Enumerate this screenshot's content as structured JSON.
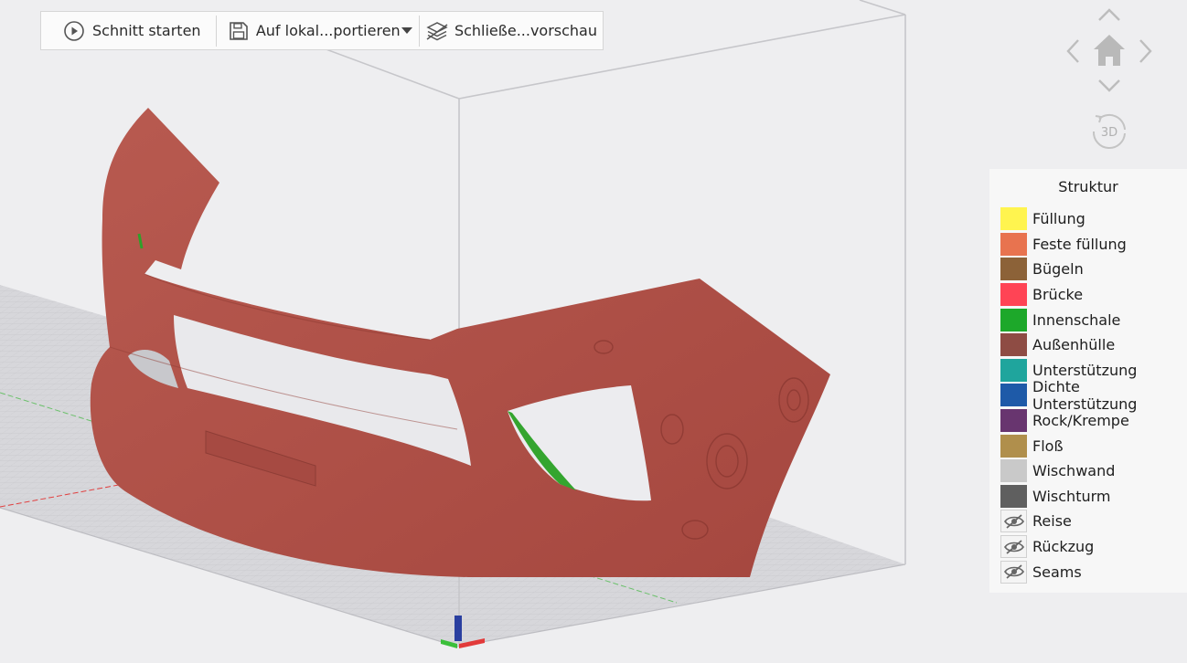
{
  "toolbar": {
    "slice_label": "Schnitt starten",
    "export_label": "Auf lokal...portieren",
    "close_preview_label": "Schließe...vorschau"
  },
  "nav": {
    "view_3d_label": "3D"
  },
  "legend": {
    "title": "Struktur",
    "items": [
      {
        "label": "Füllung",
        "color": "#fff44f",
        "visible": true
      },
      {
        "label": "Feste füllung",
        "color": "#e8734f",
        "visible": true
      },
      {
        "label": "Bügeln",
        "color": "#8c6238",
        "visible": true
      },
      {
        "label": "Brücke",
        "color": "#ff4455",
        "visible": true
      },
      {
        "label": "Innenschale",
        "color": "#1da82a",
        "visible": true
      },
      {
        "label": "Außenhülle",
        "color": "#8e4c44",
        "visible": true
      },
      {
        "label": "Unterstützung",
        "color": "#1fa59d",
        "visible": true
      },
      {
        "label": "Dichte Unterstützung",
        "color": "#1e5aa8",
        "visible": true
      },
      {
        "label": "Rock/Krempe",
        "color": "#68356f",
        "visible": true
      },
      {
        "label": "Floß",
        "color": "#b08f4c",
        "visible": true
      },
      {
        "label": "Wischwand",
        "color": "#c9c9c9",
        "visible": true
      },
      {
        "label": "Wischturm",
        "color": "#5f5f5f",
        "visible": true
      },
      {
        "label": "Reise",
        "icon": "eye-hidden-icon",
        "visible": false
      },
      {
        "label": "Rückzug",
        "icon": "eye-hidden-icon",
        "visible": false
      },
      {
        "label": "Seams",
        "icon": "eye-hidden-icon",
        "visible": false
      }
    ]
  },
  "model": {
    "color": "#b0524a",
    "inner_color": "#2fa02a"
  }
}
